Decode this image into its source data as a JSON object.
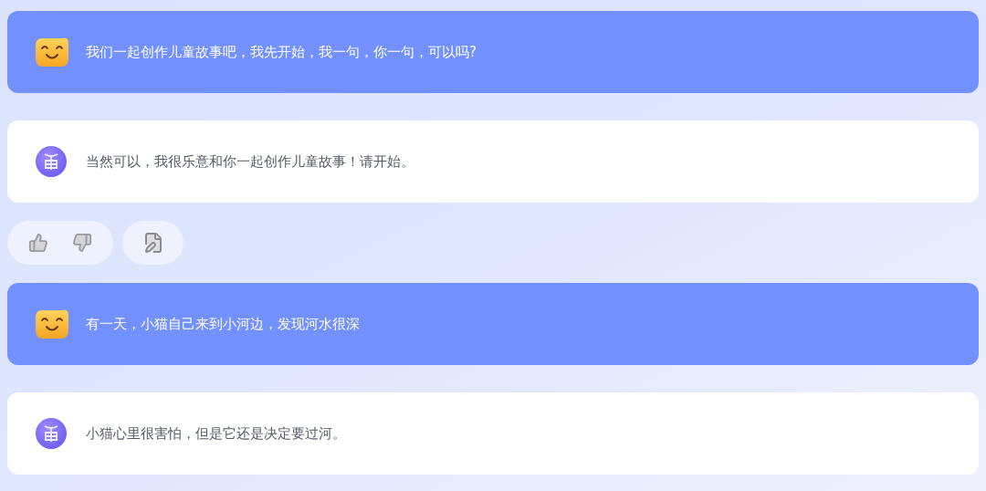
{
  "conversation": [
    {
      "kind": "user",
      "text": "我们一起创作儿童故事吧，我先开始，我一句，你一句，可以吗?"
    },
    {
      "kind": "bot",
      "text": "当然可以，我很乐意和你一起创作儿童故事！请开始。"
    },
    {
      "kind": "feedback"
    },
    {
      "kind": "user",
      "text": "有一天，小猫自己来到小河边，发现河水很深"
    },
    {
      "kind": "bot",
      "text": "小猫心里很害怕，但是它还是决定要过河。"
    }
  ]
}
